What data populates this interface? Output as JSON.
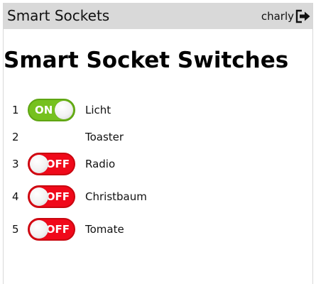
{
  "header": {
    "title": "Smart Sockets",
    "user": "charly",
    "logout_icon": "logout-icon"
  },
  "page": {
    "title": "Smart Socket Switches"
  },
  "colors": {
    "on": "#76c11f",
    "off": "#f0091a",
    "header_bg": "#d9d9d9"
  },
  "sockets": [
    {
      "number": "1",
      "name": "Licht",
      "has_toggle": true,
      "state": "on",
      "state_label": "ON"
    },
    {
      "number": "2",
      "name": "Toaster",
      "has_toggle": false
    },
    {
      "number": "3",
      "name": "Radio",
      "has_toggle": true,
      "state": "off",
      "state_label": "OFF"
    },
    {
      "number": "4",
      "name": "Christbaum",
      "has_toggle": true,
      "state": "off",
      "state_label": "OFF"
    },
    {
      "number": "5",
      "name": "Tomate",
      "has_toggle": true,
      "state": "off",
      "state_label": "OFF"
    }
  ]
}
